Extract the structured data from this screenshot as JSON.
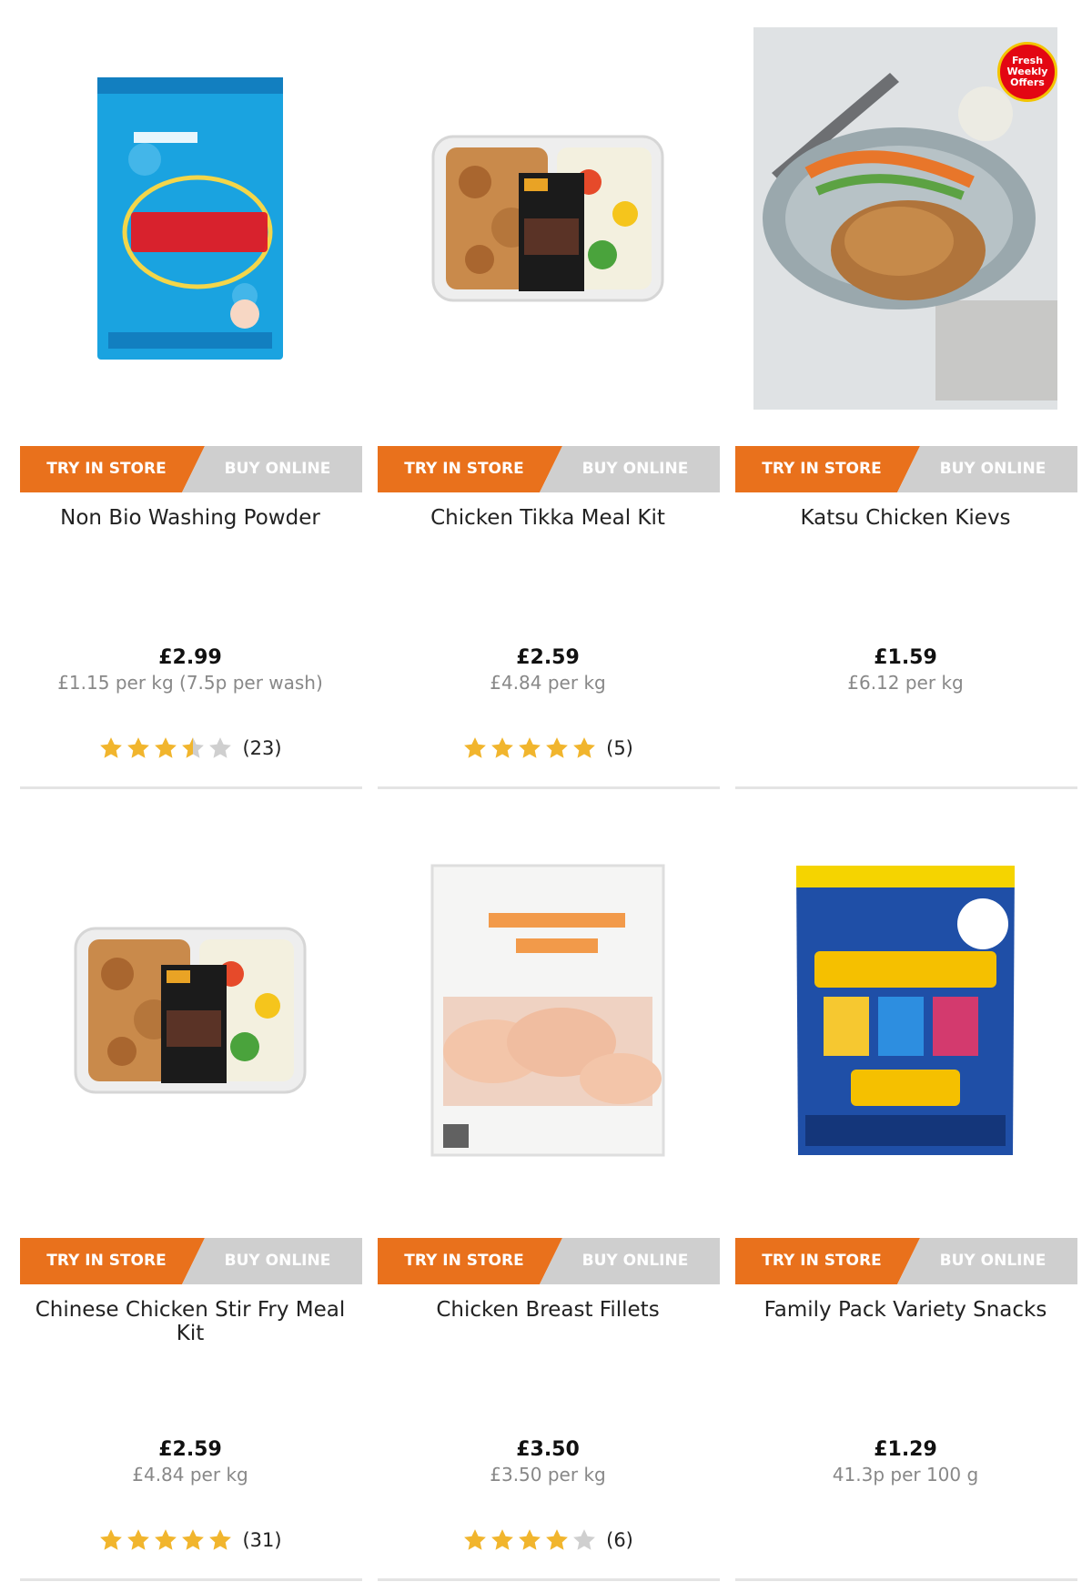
{
  "colors": {
    "accent": "#e9711c",
    "grey_tab": "#cfcfcf",
    "star": "#f1b52d",
    "star_empty": "#cfcfcf"
  },
  "labels": {
    "try_in_store": "TRY IN STORE",
    "buy_online": "BUY ONLINE"
  },
  "products": [
    {
      "name": "Non Bio Washing Powder",
      "price": "£2.99",
      "unit_price": "£1.15 per kg (7.5p per wash)",
      "rating": 3.5,
      "reviews": "(23)",
      "image": "washing-powder-box"
    },
    {
      "name": "Chicken Tikka Meal Kit",
      "price": "£2.59",
      "unit_price": "£4.84 per kg",
      "rating": 5,
      "reviews": "(5)",
      "image": "meal-kit-tray"
    },
    {
      "name": "Katsu Chicken Kievs",
      "price": "£1.59",
      "unit_price": "£6.12 per kg",
      "rating": null,
      "reviews": "",
      "image": "kiev-plate",
      "badge": "Fresh Weekly Offers"
    },
    {
      "name": "Chinese Chicken Stir Fry Meal Kit",
      "price": "£2.59",
      "unit_price": "£4.84 per kg",
      "rating": 5,
      "reviews": "(31)",
      "image": "meal-kit-tray"
    },
    {
      "name": "Chicken Breast Fillets",
      "price": "£3.50",
      "unit_price": "£3.50 per kg",
      "rating": 4,
      "reviews": "(6)",
      "image": "chicken-fillets-bag"
    },
    {
      "name": "Family Pack Variety Snacks",
      "price": "£1.29",
      "unit_price": "41.3p per 100 g",
      "rating": null,
      "reviews": "",
      "image": "snack-bag"
    }
  ]
}
